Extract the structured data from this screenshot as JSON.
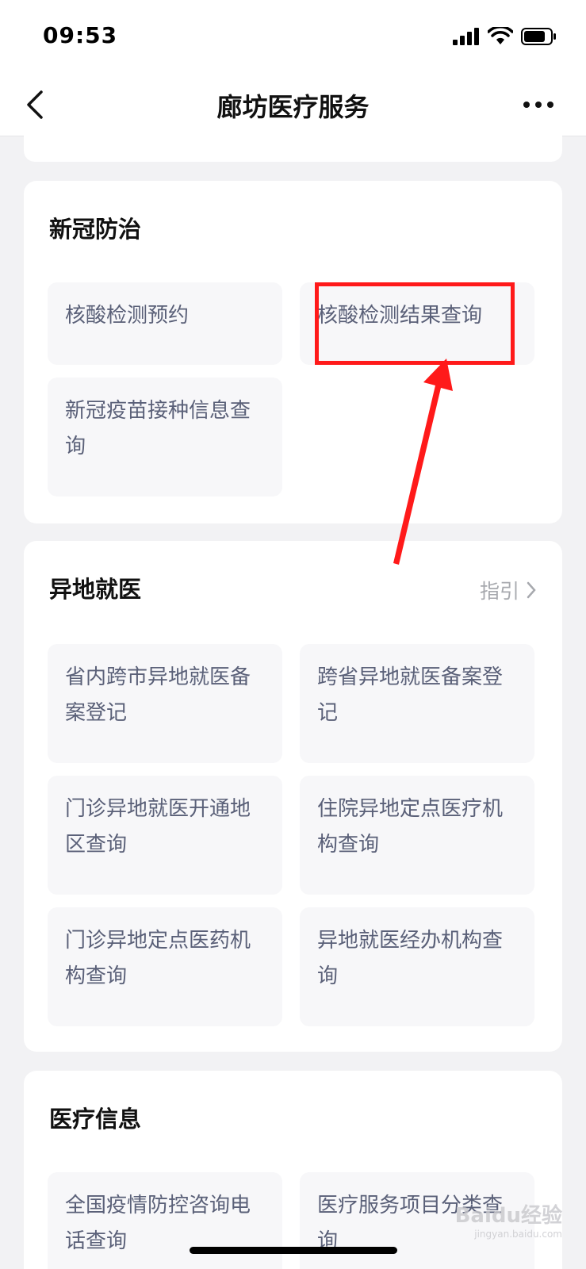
{
  "status": {
    "time": "09:53"
  },
  "nav": {
    "title": "廊坊医疗服务"
  },
  "sections": [
    {
      "title": "新冠防治",
      "items": [
        "核酸检测预约",
        "核酸检测结果查询",
        "新冠疫苗接种信息查询"
      ]
    },
    {
      "title": "异地就医",
      "guide": "指引",
      "items": [
        "省内跨市异地就医备案登记",
        "跨省异地就医备案登记",
        "门诊异地就医开通地区查询",
        "住院异地定点医疗机构查询",
        "门诊异地定点医药机构查询",
        "异地就医经办机构查询"
      ]
    },
    {
      "title": "医疗信息",
      "items": [
        "全国疫情防控咨询电话查询",
        "医疗服务项目分类查询"
      ]
    }
  ],
  "watermark": {
    "brand": "Baidu经验",
    "url": "jingyan.baidu.com"
  },
  "colors": {
    "annotation": "#ff1a1a",
    "tile_text": "#5a6078",
    "tile_bg": "#f7f7f9"
  }
}
